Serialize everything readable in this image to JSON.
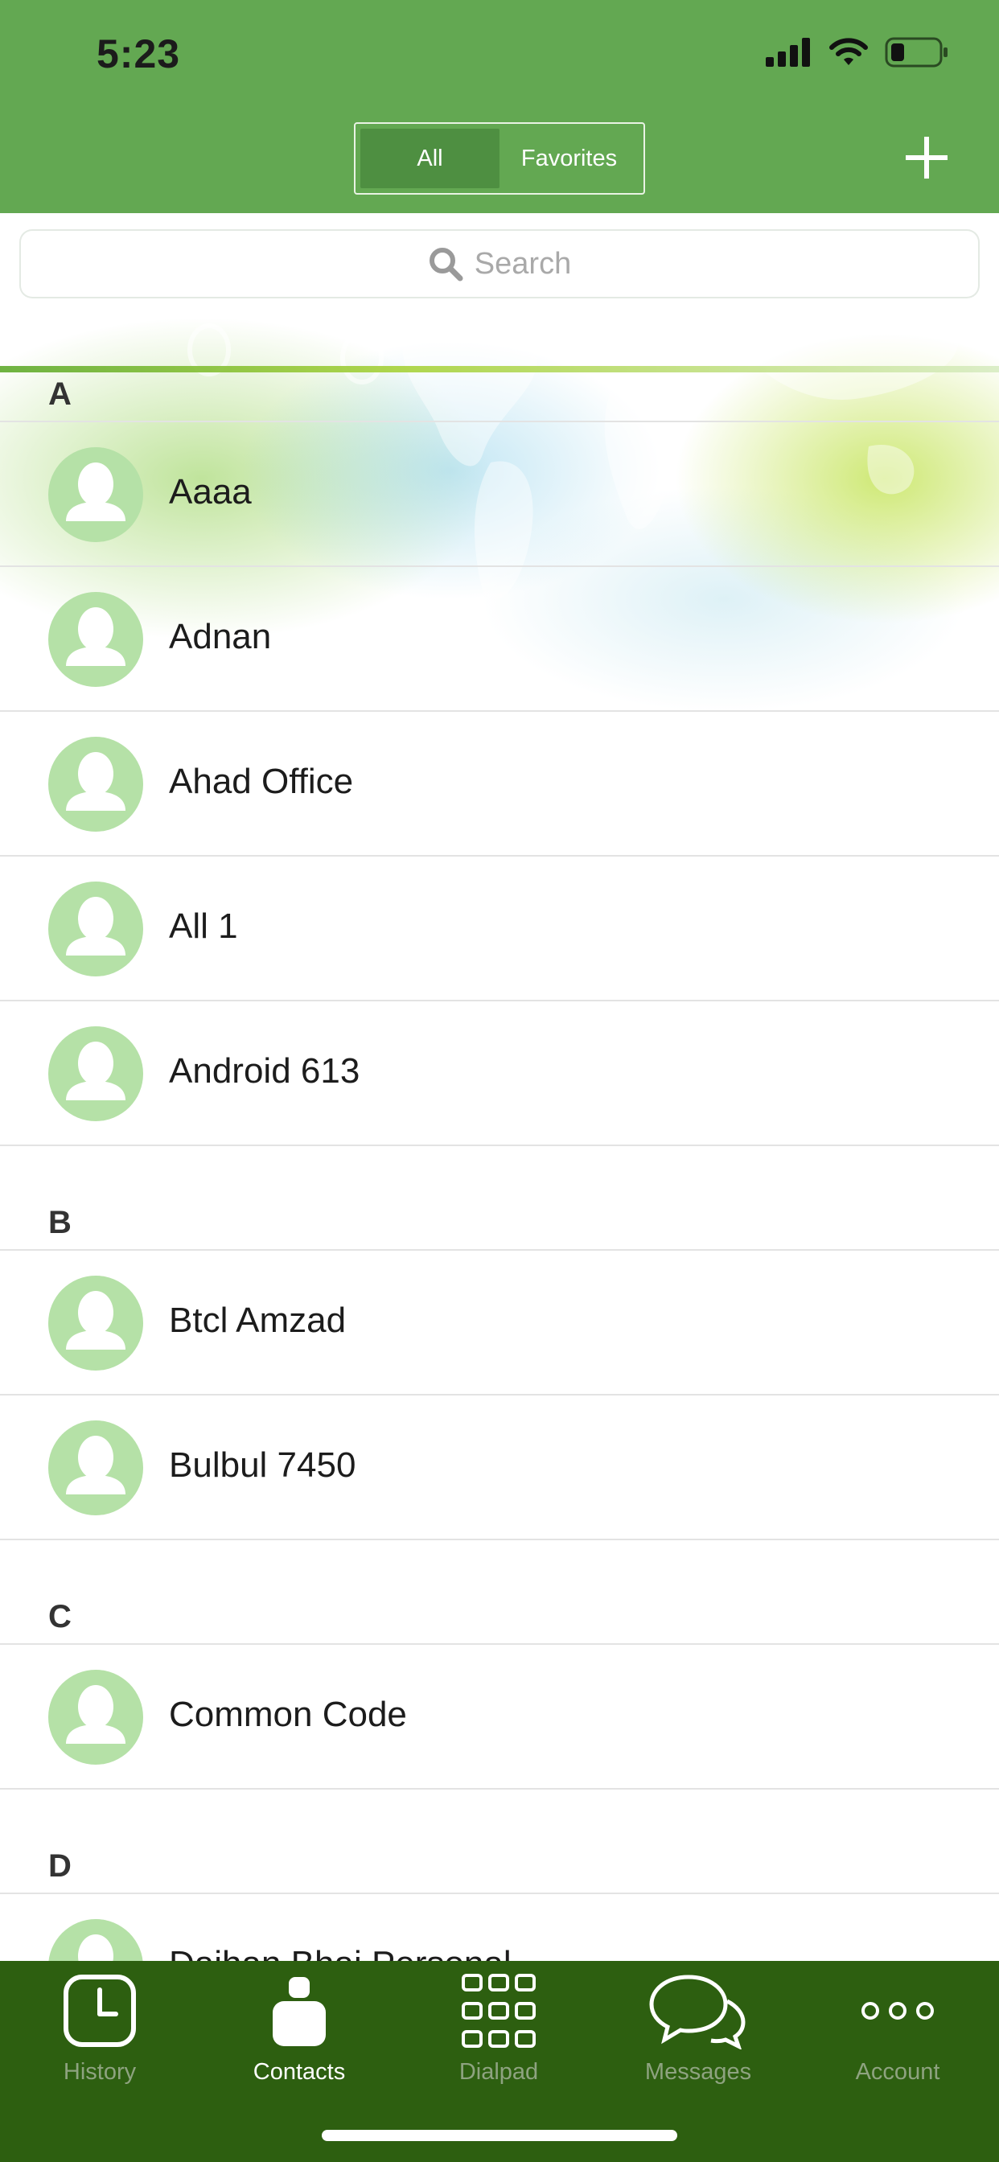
{
  "status_bar": {
    "time": "5:23"
  },
  "header": {
    "segments": [
      {
        "label": "All",
        "active": true
      },
      {
        "label": "Favorites",
        "active": false
      }
    ],
    "add_icon": "plus-icon"
  },
  "search": {
    "placeholder": "Search",
    "icon": "search-icon"
  },
  "sections": [
    {
      "letter": "A",
      "contacts": [
        "Aaaa",
        "Adnan",
        "Ahad Office",
        "All 1",
        "Android 613"
      ]
    },
    {
      "letter": "B",
      "contacts": [
        "Btcl Amzad",
        "Bulbul 7450"
      ]
    },
    {
      "letter": "C",
      "contacts": [
        "Common Code"
      ]
    },
    {
      "letter": "D",
      "contacts": [
        "Daihan Bhai Personal"
      ]
    }
  ],
  "tabbar": {
    "tabs": [
      {
        "label": "History",
        "icon": "clock-icon",
        "active": false
      },
      {
        "label": "Contacts",
        "icon": "person-icon",
        "active": true
      },
      {
        "label": "Dialpad",
        "icon": "dialpad-icon",
        "active": false
      },
      {
        "label": "Messages",
        "icon": "chat-bubbles-icon",
        "active": false
      },
      {
        "label": "Account",
        "icon": "more-dots-icon",
        "active": false
      }
    ]
  },
  "colors": {
    "header_green": "#63a852",
    "tabbar_green": "#2d5f10",
    "avatar_green": "#b5e1a7"
  }
}
